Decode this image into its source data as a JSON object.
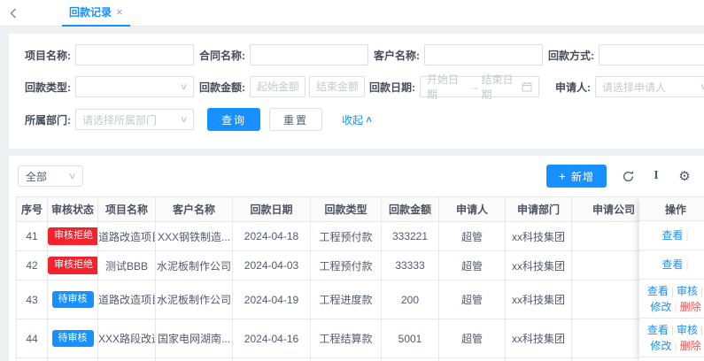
{
  "colors": {
    "primary": "#1890ff",
    "danger": "#f5222d",
    "delete": "#ff4d4f"
  },
  "icons": {
    "back": "‹",
    "close": "×",
    "chevron_down": "∨",
    "collapse_up": "∧",
    "plus": "+",
    "arrow_right": "→",
    "column_height": "I",
    "gear": "⚙"
  },
  "tabbar": {
    "tab_label": "回款记录"
  },
  "filter": {
    "project_label": "项目名称:",
    "contract_label": "合同名称:",
    "customer_label": "客户名称:",
    "method_label": "回款方式:",
    "type_label": "回款类型:",
    "amount_label": "回款金额:",
    "amount_start_ph": "起始金额",
    "amount_end_ph": "结束金额",
    "date_label": "回款日期:",
    "date_start_ph": "开始日期",
    "date_end_ph": "结束日期",
    "applicant_label": "申请人:",
    "applicant_ph": "请选择申请人",
    "dept_label": "所属部门:",
    "dept_ph": "请选择所属部门",
    "search_btn": "查询",
    "reset_btn": "重置",
    "collapse_label": "收起"
  },
  "toolbar": {
    "scope_value": "全部",
    "add_label": "新增"
  },
  "table": {
    "headers": [
      "序号",
      "审核状态",
      "项目名称",
      "客户名称",
      "回款日期",
      "回款类型",
      "回款金额",
      "申请人",
      "申请部门",
      "申请公司",
      "操作"
    ],
    "rows": [
      {
        "seq": "41",
        "status": "审核拒绝",
        "project": "道路改造项目x...",
        "customer": "XXX钢铁制造...",
        "date": "2024-04-18",
        "type": "工程预付款",
        "amount": "333221",
        "applicant": "超管",
        "dept": "xx科技集团",
        "company": "",
        "actions": [
          "查看"
        ]
      },
      {
        "seq": "42",
        "status": "审核拒绝",
        "project": "测试BBB",
        "customer": "水泥板制作公司",
        "date": "2024-04-03",
        "type": "工程预付款",
        "amount": "33333",
        "applicant": "超管",
        "dept": "xx科技集团",
        "company": "",
        "actions": [
          "查看"
        ]
      },
      {
        "seq": "43",
        "status": "待审核",
        "project": "道路改造项目x...",
        "customer": "水泥板制作公司",
        "date": "2024-04-19",
        "type": "工程进度款",
        "amount": "200",
        "applicant": "超管",
        "dept": "xx科技集团",
        "company": "",
        "actions": [
          "查看",
          "审核",
          "修改",
          "删除"
        ]
      },
      {
        "seq": "44",
        "status": "待审核",
        "project": "XXX路段改造...",
        "customer": "国家电网湖南...",
        "date": "2024-04-16",
        "type": "工程结算款",
        "amount": "5001",
        "applicant": "超管",
        "dept": "xx科技集团",
        "company": "",
        "actions": [
          "查看",
          "审核",
          "修改",
          "删除"
        ]
      }
    ]
  }
}
